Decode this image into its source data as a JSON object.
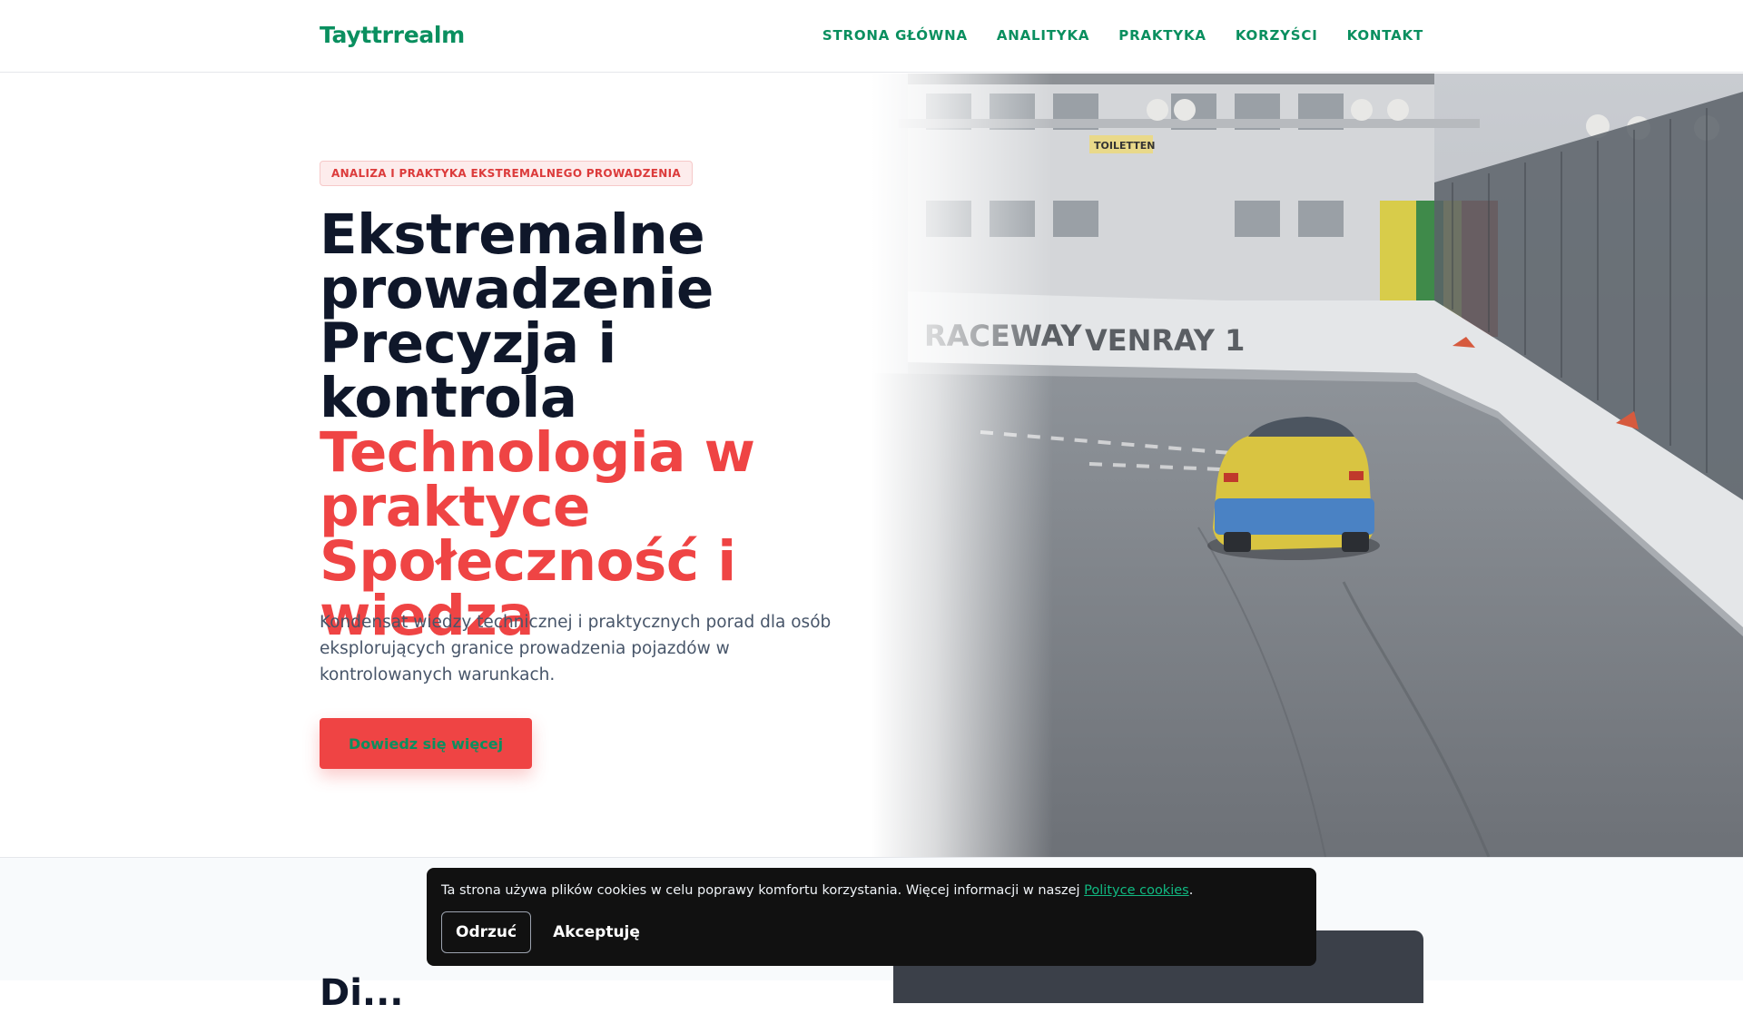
{
  "header": {
    "logo": "Tayttrrealm",
    "nav": [
      {
        "label": "STRONA GŁÓWNA"
      },
      {
        "label": "ANALITYKA"
      },
      {
        "label": "PRAKTYKA"
      },
      {
        "label": "KORZYŚCI"
      },
      {
        "label": "KONTAKT"
      }
    ]
  },
  "hero": {
    "tagline": "ANALIZA I PRAKTYKA EKSTREMALNEGO PROWADZENIA",
    "headline_dark": [
      "Ekstremalne prowadzenie",
      "Precyzja i kontrola"
    ],
    "headline_red": [
      "Technologia w praktyce",
      "Społeczność i wiedza"
    ],
    "intro": "Kondensat wiedzy technicznej i praktycznych porad dla osób eksplorujących granice prowadzenia pojazdów w kontrolowanych warunkach.",
    "cta_label": "Dowiedz się więcej",
    "image": {
      "description": "race car on track",
      "signs": [
        "TOILETTEN",
        "RACEWAY",
        "VENRAY 1"
      ]
    }
  },
  "section2": {
    "heading_partial": "Di..."
  },
  "cookie": {
    "text": "Ta strona używa plików cookies w celu poprawy komfortu korzystania. Więcej informacji w naszej ",
    "link_label": "Polityce cookies",
    "text_end": ".",
    "reject_label": "Odrzuć",
    "accept_label": "Akceptuję"
  },
  "colors": {
    "brand_green": "#0a8f5f",
    "accent_red": "#ef4444",
    "heading_dark": "#0f172a",
    "body_gray": "#475569",
    "cookie_bg": "#111111"
  }
}
